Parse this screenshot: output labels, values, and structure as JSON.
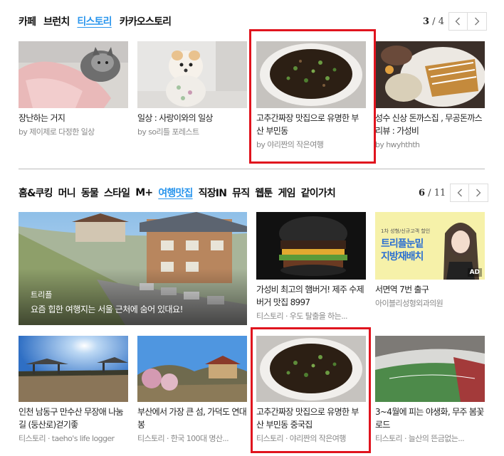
{
  "section1": {
    "tabs": [
      {
        "label": "카페",
        "active": false
      },
      {
        "label": "브런치",
        "active": false
      },
      {
        "label": "티스토리",
        "active": true
      },
      {
        "label": "카카오스토리",
        "active": false
      }
    ],
    "pager": {
      "current": "3",
      "sep": " / ",
      "total": "4"
    },
    "cards": [
      {
        "title": "장난하는 거지",
        "source": "by 제이제로 다정한 일상",
        "image": "cat-photo"
      },
      {
        "title": "일상 : 사랑이와의 일상",
        "source": "by so리틀 포레스트",
        "image": "dog-photo"
      },
      {
        "title": "고추간짜장 맛집으로 유명한 부산 부민동",
        "source": "by 야리짠의 작은여행",
        "image": "jjajang-photo"
      },
      {
        "title": "성수 신상 돈까스집 , 무공돈까스 리뷰 : 가성비",
        "source": "by hwyhthth",
        "image": "tonkatsu-photo"
      }
    ]
  },
  "section2": {
    "tabs": [
      {
        "label": "홈&쿠킹",
        "active": false
      },
      {
        "label": "머니",
        "active": false
      },
      {
        "label": "동물",
        "active": false
      },
      {
        "label": "스타일",
        "active": false
      },
      {
        "label": "M+",
        "active": false
      },
      {
        "label": "여행맛집",
        "active": true
      },
      {
        "label": "직장IN",
        "active": false
      },
      {
        "label": "뮤직",
        "active": false
      },
      {
        "label": "웹툰",
        "active": false
      },
      {
        "label": "게임",
        "active": false
      },
      {
        "label": "같이가치",
        "active": false
      }
    ],
    "pager": {
      "current": "6",
      "sep": " / ",
      "total": "11"
    },
    "featured": {
      "category": "트리플",
      "title": "요즘 힙한 여행지는 서울 근처에 숨어 있대요!"
    },
    "cards_row1": [
      {
        "title": "가성비 최고의 햄버거! 제주 수제버거 맛집 8997",
        "source": "티스토리 · 우도 탈출을 하는...",
        "image": "burger-photo"
      },
      {
        "title": "서면역 7번 출구",
        "source": "아이블리성형외과의원",
        "image": "ad-banner",
        "ad_label": "AD",
        "ad_headline": "트리플눈밑",
        "ad_sub": "지방재배치",
        "ad_top": "1차 성형/신규고객 할인"
      }
    ],
    "cards_row2": [
      {
        "title": "인천 남동구 만수산 무장애 나눔길 (둥산로)걷기좋",
        "source": "티스토리 · taeho's life logger",
        "image": "park-photo"
      },
      {
        "title": "부산에서 가장 큰 섬, 가덕도 연대봉",
        "source": "티스토리 · 한국 100대 명산...",
        "image": "mountain-photo"
      },
      {
        "title": "고추간짜장 맛집으로 유명한 부산 부민동 중국집",
        "source": "티스토리 · 야리짠의 작은여행",
        "image": "jjajang-photo"
      },
      {
        "title": "3~4월에 피는 야생화, 무주 봄꽃 로드",
        "source": "티스토리 · 늘산의 뜬금없는...",
        "image": "stadium-photo"
      }
    ]
  },
  "colors": {
    "accent": "#2b96ed",
    "highlight": "#e0141e"
  }
}
